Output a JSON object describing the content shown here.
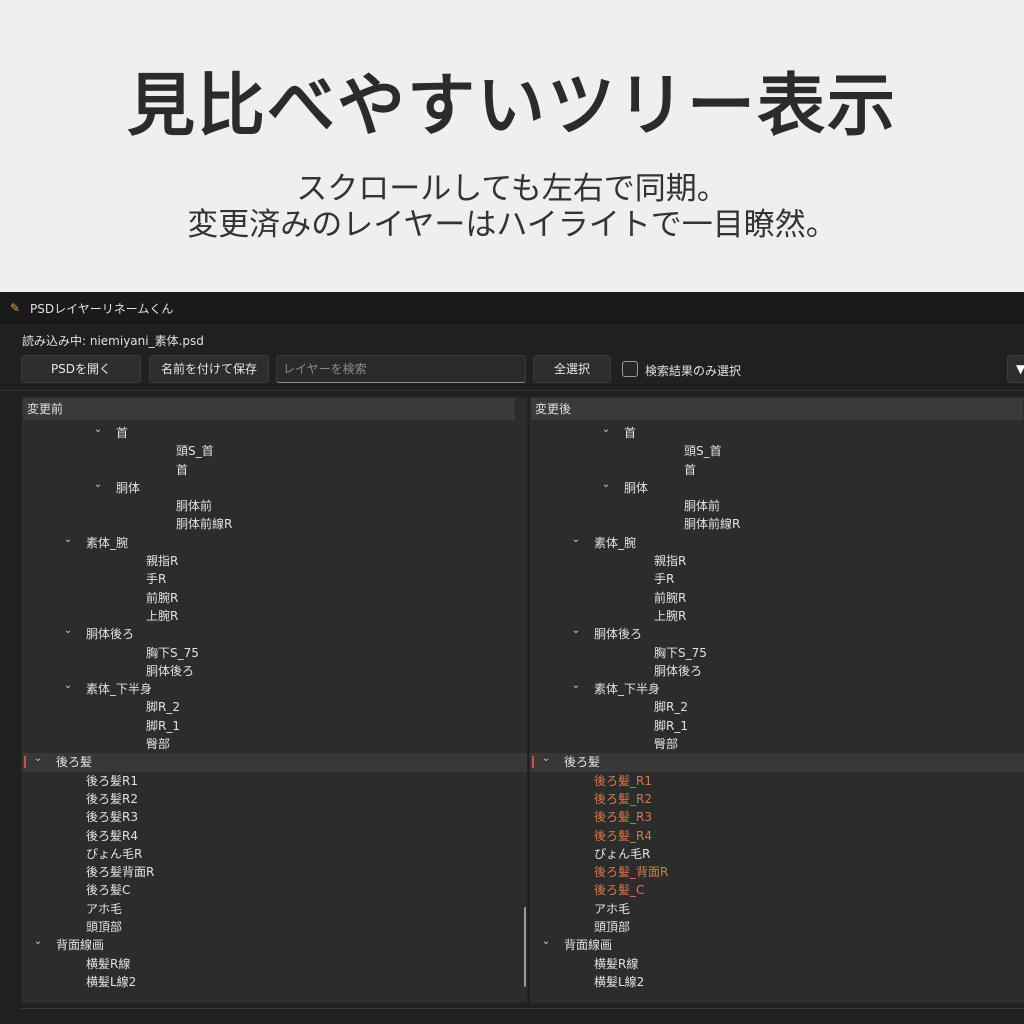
{
  "promo": {
    "headline": "見比べやすいツリー表示",
    "sub1": "スクロールしても左右で同期。",
    "sub2": "変更済みのレイヤーはハイライトで一目瞭然。"
  },
  "app": {
    "title": "PSDレイヤーリネームくん",
    "loading": "読み込み中: niemiyani_素体.psd",
    "toolbar": {
      "open": "PSDを開く",
      "save": "名前を付けて保存",
      "search_placeholder": "レイヤーを検索",
      "select_all": "全選択",
      "search_only": "検索結果のみ選択",
      "menu": "▼"
    },
    "colors": {
      "changed": "#d6784a",
      "marker": "#d24a4a"
    },
    "left_header": "変更前",
    "right_header": "変更後",
    "left_tree": [
      {
        "label": "首",
        "level": 2,
        "expand": true
      },
      {
        "label": "頭S_首",
        "level": 4
      },
      {
        "label": "首",
        "level": 4
      },
      {
        "label": "胴体",
        "level": 2,
        "expand": true
      },
      {
        "label": "胴体前",
        "level": 4
      },
      {
        "label": "胴体前線R",
        "level": 4
      },
      {
        "label": "素体_腕",
        "level": 1,
        "expand": true
      },
      {
        "label": "親指R",
        "level": 3
      },
      {
        "label": "手R",
        "level": 3
      },
      {
        "label": "前腕R",
        "level": 3
      },
      {
        "label": "上腕R",
        "level": 3
      },
      {
        "label": "胴体後ろ",
        "level": 1,
        "expand": true
      },
      {
        "label": "胸下S_75",
        "level": 3
      },
      {
        "label": "胴体後ろ",
        "level": 3
      },
      {
        "label": "素体_下半身",
        "level": 1,
        "expand": true
      },
      {
        "label": "脚R_2",
        "level": 3
      },
      {
        "label": "脚R_1",
        "level": 3
      },
      {
        "label": "臀部",
        "level": 3
      },
      {
        "label": "後ろ髪",
        "level": 0,
        "expand": true,
        "selected": true
      },
      {
        "label": "後ろ髪R1",
        "level": 1
      },
      {
        "label": "後ろ髪R2",
        "level": 1
      },
      {
        "label": "後ろ髪R3",
        "level": 1
      },
      {
        "label": "後ろ髪R4",
        "level": 1
      },
      {
        "label": "ぴょん毛R",
        "level": 1
      },
      {
        "label": "後ろ髪背面R",
        "level": 1
      },
      {
        "label": "後ろ髪C",
        "level": 1
      },
      {
        "label": "アホ毛",
        "level": 1
      },
      {
        "label": "頭頂部",
        "level": 1
      },
      {
        "label": "背面線画",
        "level": 0,
        "expand": true
      },
      {
        "label": "横髪R線",
        "level": 1
      },
      {
        "label": "横髪L線2",
        "level": 1
      }
    ],
    "right_tree": [
      {
        "label": "首",
        "level": 2,
        "expand": true
      },
      {
        "label": "頭S_首",
        "level": 4
      },
      {
        "label": "首",
        "level": 4
      },
      {
        "label": "胴体",
        "level": 2,
        "expand": true
      },
      {
        "label": "胴体前",
        "level": 4
      },
      {
        "label": "胴体前線R",
        "level": 4
      },
      {
        "label": "素体_腕",
        "level": 1,
        "expand": true
      },
      {
        "label": "親指R",
        "level": 3
      },
      {
        "label": "手R",
        "level": 3
      },
      {
        "label": "前腕R",
        "level": 3
      },
      {
        "label": "上腕R",
        "level": 3
      },
      {
        "label": "胴体後ろ",
        "level": 1,
        "expand": true
      },
      {
        "label": "胸下S_75",
        "level": 3
      },
      {
        "label": "胴体後ろ",
        "level": 3
      },
      {
        "label": "素体_下半身",
        "level": 1,
        "expand": true
      },
      {
        "label": "脚R_2",
        "level": 3
      },
      {
        "label": "脚R_1",
        "level": 3
      },
      {
        "label": "臀部",
        "level": 3
      },
      {
        "label": "後ろ髪",
        "level": 0,
        "expand": true,
        "selected": true
      },
      {
        "label": "後ろ髪_R1",
        "level": 1,
        "changed": true
      },
      {
        "label": "後ろ髪_R2",
        "level": 1,
        "changed": true
      },
      {
        "label": "後ろ髪_R3",
        "level": 1,
        "changed": true
      },
      {
        "label": "後ろ髪_R4",
        "level": 1,
        "changed": true
      },
      {
        "label": "ぴょん毛R",
        "level": 1
      },
      {
        "label": "後ろ髪_背面R",
        "level": 1,
        "changed": true
      },
      {
        "label": "後ろ髪_C",
        "level": 1,
        "changed": true
      },
      {
        "label": "アホ毛",
        "level": 1
      },
      {
        "label": "頭頂部",
        "level": 1
      },
      {
        "label": "背面線画",
        "level": 0,
        "expand": true
      },
      {
        "label": "横髪R線",
        "level": 1
      },
      {
        "label": "横髪L線2",
        "level": 1
      }
    ]
  }
}
